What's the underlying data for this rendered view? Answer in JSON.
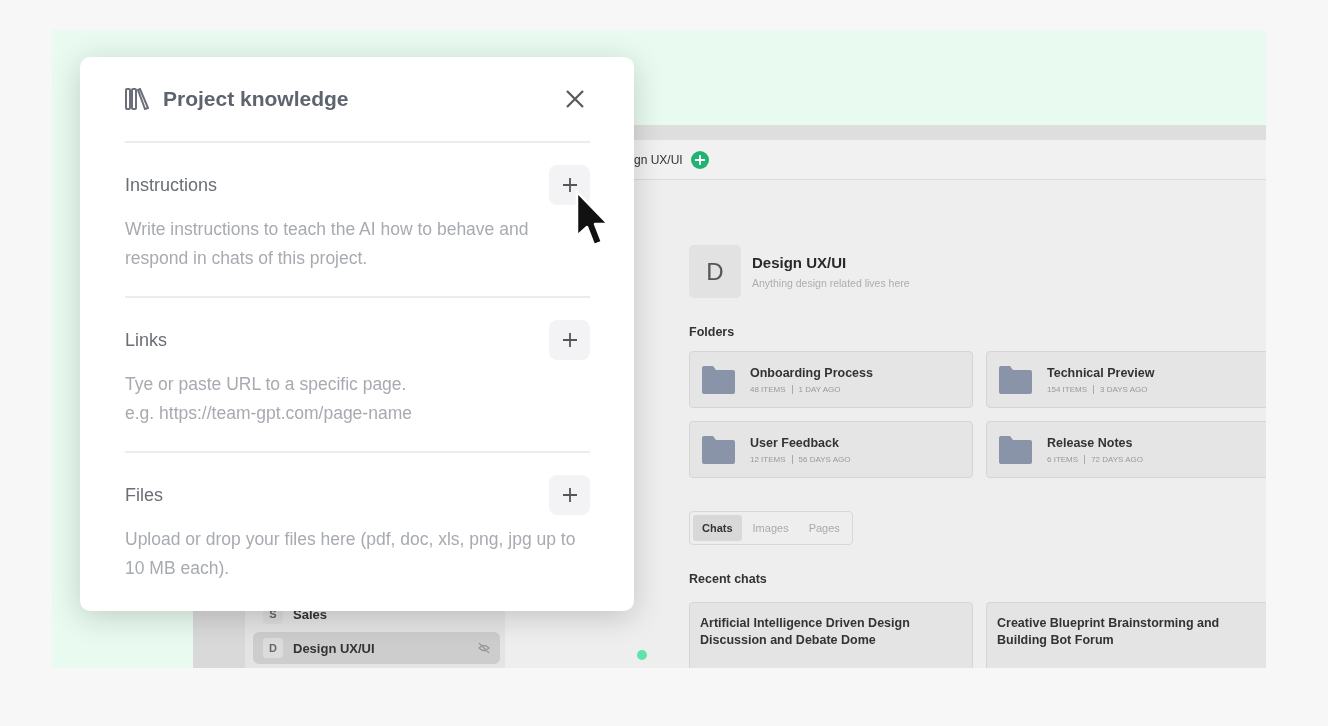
{
  "dialog": {
    "title": "Project knowledge",
    "sections": [
      {
        "title": "Instructions",
        "description": "Write instructions to teach the AI how to behave and respond in chats of this project."
      },
      {
        "title": "Links",
        "description": "Tye or paste URL to a specific page.\ne.g. https://team-gpt.com/page-name"
      },
      {
        "title": "Files",
        "description": "Upload or drop your files here (pdf, doc, xls, png, jpg up to 10 MB each)."
      }
    ]
  },
  "app": {
    "breadcrumb": "gn UX/UI",
    "sidebar": {
      "items": [
        {
          "initial": "S",
          "label": "Sales",
          "selected": false
        },
        {
          "initial": "D",
          "label": "Design UX/UI",
          "selected": true
        }
      ]
    },
    "project": {
      "initial": "D",
      "name": "Design UX/UI",
      "description": "Anything design related lives here"
    },
    "folders_heading": "Folders",
    "folders": [
      {
        "name": "Onboarding Process",
        "items": "48 ITEMS",
        "age": "1 DAY AGO"
      },
      {
        "name": "Technical Preview",
        "items": "154 ITEMS",
        "age": "3 DAYS AGO"
      },
      {
        "name": "User Feedback",
        "items": "12 ITEMS",
        "age": "56 DAYS AGO"
      },
      {
        "name": "Release Notes",
        "items": "6 ITEMS",
        "age": "72 DAYS AGO"
      }
    ],
    "tabs": [
      {
        "label": "Chats",
        "selected": true
      },
      {
        "label": "Images",
        "selected": false
      },
      {
        "label": "Pages",
        "selected": false
      }
    ],
    "recent_heading": "Recent chats",
    "chats": [
      {
        "title": "Artificial Intelligence Driven Design Discussion and Debate Dome"
      },
      {
        "title": "Creative Blueprint Brainstorming and Building Bot Forum"
      }
    ]
  }
}
